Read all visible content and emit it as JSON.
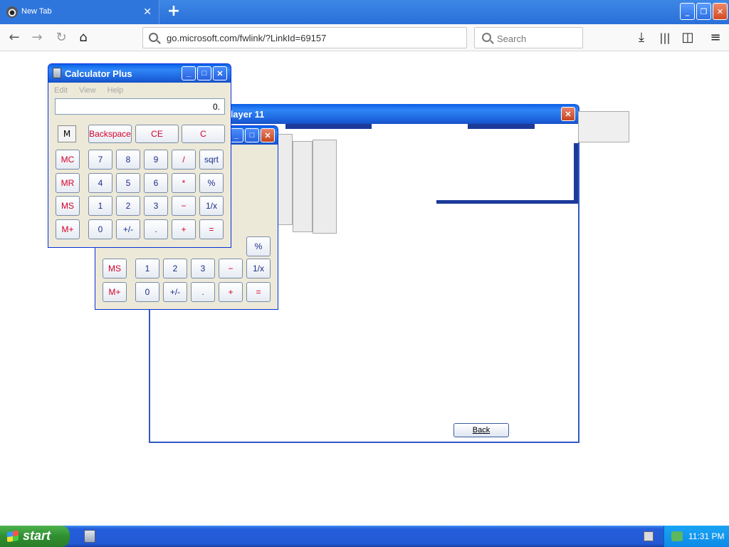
{
  "browser": {
    "tab_title": "New Tab",
    "url": "go.microsoft.com/fwlink/?LinkId=69157",
    "search_placeholder": "Search"
  },
  "icons": {
    "back": "arrow-left-icon",
    "forward": "arrow-right-icon",
    "reload": "reload-icon",
    "home": "home-icon",
    "download": "download-icon",
    "library": "library-icon",
    "sidebar": "sidebar-icon",
    "menu": "hamburger-menu-icon"
  },
  "media_player": {
    "title": "Player 11",
    "back_label": "Back"
  },
  "calculator_front": {
    "title": "Calculator Plus",
    "menu": [
      "Edit",
      "View",
      "Help"
    ],
    "display": "0.",
    "memory_indicator": "M",
    "top_row": [
      "Backspace",
      "CE",
      "C"
    ],
    "memory_buttons": [
      "MC",
      "MR",
      "MS",
      "M+"
    ],
    "rows": [
      [
        "7",
        "8",
        "9",
        "/",
        "sqrt"
      ],
      [
        "4",
        "5",
        "6",
        "*",
        "%"
      ],
      [
        "1",
        "2",
        "3",
        "−",
        "1/x"
      ],
      [
        "0",
        "+/-",
        ".",
        "+",
        "="
      ]
    ]
  },
  "calculator_back": {
    "visible_memory": [
      "MS",
      "M+"
    ],
    "row_partial": [
      "%"
    ],
    "rows": [
      [
        "1",
        "2",
        "3",
        "−",
        "1/x"
      ],
      [
        "0",
        "+/-",
        ".",
        "+",
        "="
      ]
    ]
  },
  "taskbar": {
    "start_label": "start",
    "clock": "11:31 PM"
  },
  "colors": {
    "xp_blue": "#245edb",
    "calc_red": "#d4002a",
    "calc_blue": "#1a2e8a"
  }
}
